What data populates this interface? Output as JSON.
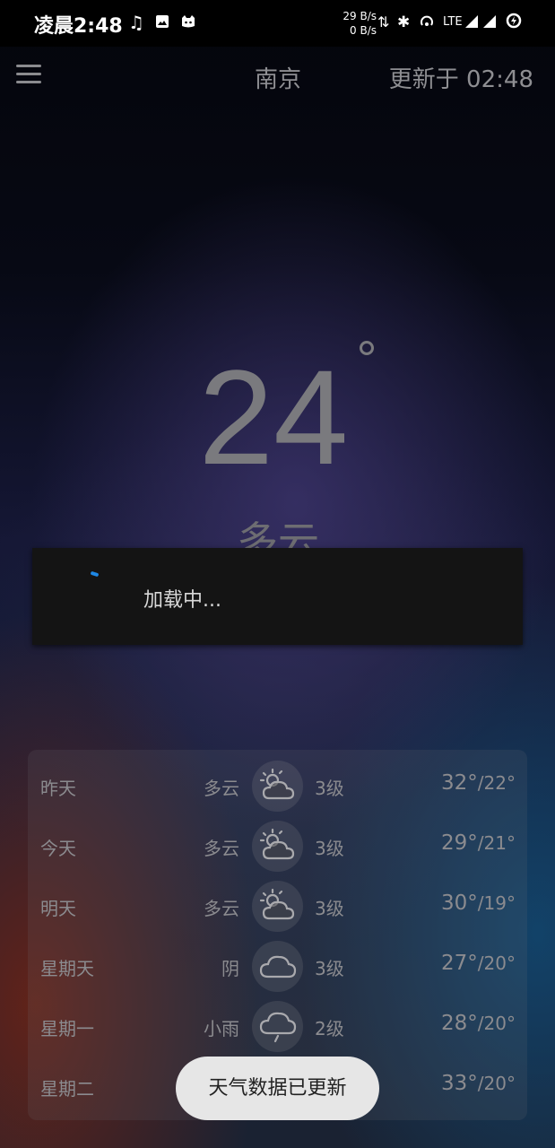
{
  "status_bar": {
    "time": "凌晨2:48",
    "up_speed": "29 B/s",
    "down_speed": "0 B/s",
    "network": "LTE",
    "icons": [
      "music-icon",
      "image-icon",
      "cat-app-icon",
      "data-arrows-icon",
      "bluetooth-icon",
      "hotspot-icon",
      "signal-icon",
      "signal-icon",
      "battery-icon"
    ]
  },
  "header": {
    "city": "南京",
    "updated": "更新于 02:48"
  },
  "current": {
    "temperature": "24",
    "condition": "多云"
  },
  "dialog": {
    "text": "加载中...",
    "accent": "#1e88e5"
  },
  "forecast": [
    {
      "day": "昨天",
      "condition": "多云",
      "icon": "partly-cloudy-icon",
      "wind": "3级",
      "high": "32°",
      "low": "22°"
    },
    {
      "day": "今天",
      "condition": "多云",
      "icon": "partly-cloudy-icon",
      "wind": "3级",
      "high": "29°",
      "low": "21°"
    },
    {
      "day": "明天",
      "condition": "多云",
      "icon": "partly-cloudy-icon",
      "wind": "3级",
      "high": "30°",
      "low": "19°"
    },
    {
      "day": "星期天",
      "condition": "阴",
      "icon": "cloud-icon",
      "wind": "3级",
      "high": "27°",
      "low": "20°"
    },
    {
      "day": "星期一",
      "condition": "小雨",
      "icon": "light-rain-icon",
      "wind": "2级",
      "high": "28°",
      "low": "20°"
    },
    {
      "day": "星期二",
      "condition": "",
      "icon": "",
      "wind": "",
      "high": "33°",
      "low": "20°"
    }
  ],
  "toast": {
    "text": "天气数据已更新"
  }
}
